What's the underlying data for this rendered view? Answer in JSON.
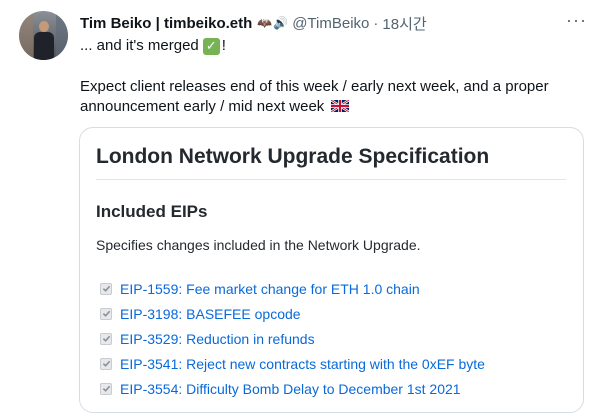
{
  "tweet": {
    "author_name": "Tim Beiko | timbeiko.eth",
    "name_emoji": [
      "🦇",
      "🔊"
    ],
    "handle": "@TimBeiko",
    "separator": "·",
    "time": "18시간",
    "more_label": "···",
    "text_line1": "... and it's merged",
    "check_emoji": "✓",
    "text_line1_end": "!",
    "text_line2": "Expect client releases end of this week / early next week, and a proper announcement early / mid next week"
  },
  "card": {
    "title": "London Network Upgrade Specification",
    "section_heading": "Included EIPs",
    "description": "Specifies changes included in the Network Upgrade.",
    "items": [
      {
        "label": "EIP-1559: Fee market change for ETH 1.0 chain",
        "checked": true
      },
      {
        "label": "EIP-3198: BASEFEE opcode",
        "checked": true
      },
      {
        "label": "EIP-3529: Reduction in refunds",
        "checked": true
      },
      {
        "label": "EIP-3541: Reject new contracts starting with the 0xEF byte",
        "checked": true
      },
      {
        "label": "EIP-3554: Difficulty Bomb Delay to December 1st 2021",
        "checked": true
      }
    ]
  },
  "colors": {
    "link": "#0969da",
    "muted": "#536471",
    "check_green": "#77b255"
  },
  "icons": [
    "avatar",
    "bat-emoji",
    "speaker-emoji",
    "more-icon",
    "check-mark-emoji",
    "uk-flag-emoji",
    "checkbox-icon"
  ]
}
